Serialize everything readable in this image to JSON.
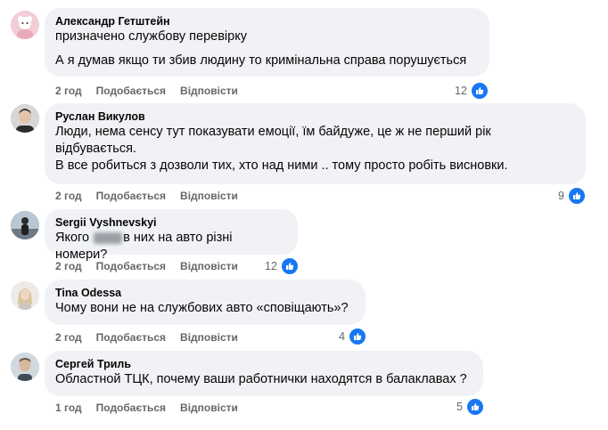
{
  "comments": [
    {
      "author": "Александр Гетштейн",
      "lines": [
        "призначено службову перевірку",
        "А я думав якщо ти збив людину то кримінальна справа порушується"
      ],
      "time": "2 год",
      "like_label": "Подобається",
      "reply_label": "Відповісти",
      "reactions": "12"
    },
    {
      "author": "Руслан Викулов",
      "lines": [
        "Люди, нема сенсу тут показувати емоції, їм байдуже, це ж не перший рік відбувається.",
        "В все робиться з дозволи тих, хто над ними .. тому просто робіть висновки."
      ],
      "time": "2 год",
      "like_label": "Подобається",
      "reply_label": "Відповісти",
      "reactions": "9"
    },
    {
      "author": "Sergii Vyshnevskyi",
      "text_before": "Якого ",
      "text_after": "в них на авто різні номери?",
      "time": "2 год",
      "like_label": "Подобається",
      "reply_label": "Відповісти",
      "reactions": "12"
    },
    {
      "author": "Tina Odessa",
      "lines": [
        "Чому вони не на службових авто «сповіщають»?"
      ],
      "time": "2 год",
      "like_label": "Подобається",
      "reply_label": "Відповісти",
      "reactions": "4"
    },
    {
      "author": "Сергей Триль",
      "lines": [
        "Областной ТЦК, почему ваши работнички находятся в балаклавах ?"
      ],
      "time": "1 год",
      "like_label": "Подобається",
      "reply_label": "Відповісти",
      "reactions": "5"
    }
  ],
  "colors": {
    "bubble": "#f0f2f5",
    "meta": "#65676b",
    "like": "#1877f2"
  }
}
